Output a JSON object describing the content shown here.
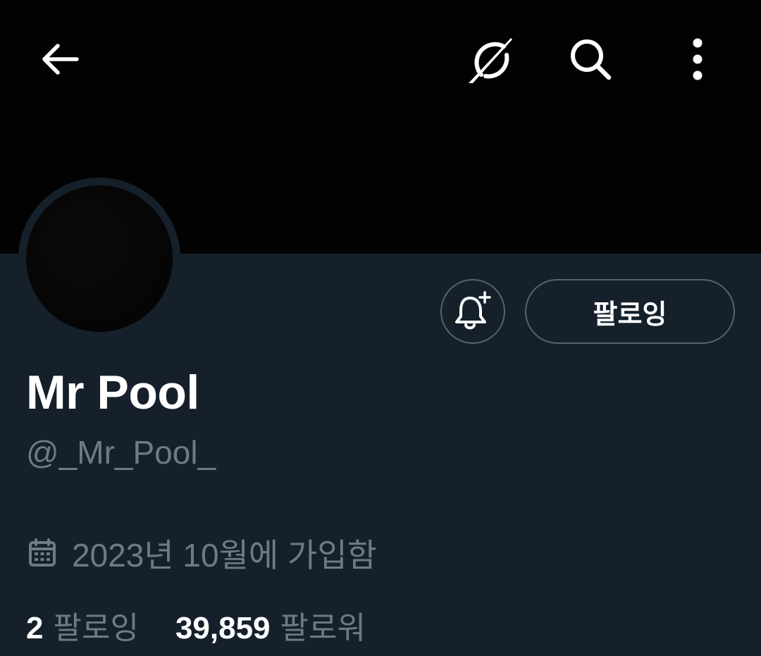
{
  "profile": {
    "display_name": "Mr Pool",
    "handle": "@_Mr_Pool_",
    "joined": "2023년 10월에 가입함",
    "following_button_label": "팔로잉"
  },
  "stats": {
    "following_count": "2",
    "following_label": "팔로잉",
    "followers_count": "39,859",
    "followers_label": "팔로워"
  },
  "icons": {
    "back": "arrow-left-icon",
    "grok": "grok-icon",
    "search": "search-icon",
    "more": "more-vertical-icon",
    "notify": "bell-plus-icon",
    "calendar": "calendar-icon"
  },
  "colors": {
    "background": "#15202b",
    "banner": "#020202",
    "secondary_text": "#6e7a86",
    "border": "#536471"
  }
}
